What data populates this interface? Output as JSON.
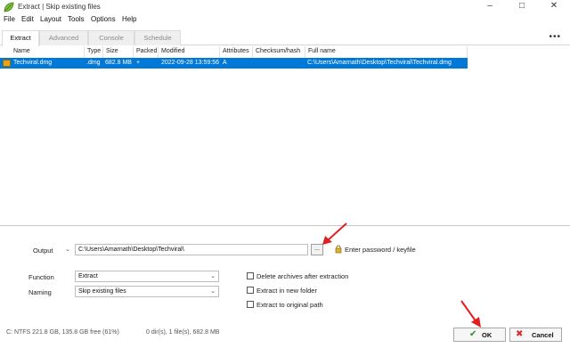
{
  "window": {
    "title": "Extract | Skip existing files"
  },
  "menu": [
    "File",
    "Edit",
    "Layout",
    "Tools",
    "Options",
    "Help"
  ],
  "tabs": [
    "Extract",
    "Advanced",
    "Console",
    "Schedule"
  ],
  "columns": [
    "Name",
    "Type",
    "Size",
    "Packed",
    "Modified",
    "Attributes",
    "Checksum/hash",
    "Full name"
  ],
  "files": [
    {
      "name": "Techviral.dmg",
      "type": ".dmg",
      "size": "682.8 MB",
      "packed": "+",
      "modified": "2022-09-28 13:59:56",
      "attributes": "A",
      "checksum": "",
      "fullname": "C:\\Users\\Amarnath\\Desktop\\Techviral\\Techviral.dmg"
    }
  ],
  "output": {
    "label": "Output",
    "path": "C:\\Users\\Amarnath\\Desktop\\Techviral\\",
    "browse_label": "...",
    "password_label": "Enter password / keyfile"
  },
  "function": {
    "label": "Function",
    "value": "Extract"
  },
  "naming": {
    "label": "Naming",
    "value": "Skip existing files"
  },
  "options": [
    "Delete archives after extraction",
    "Extract in new folder",
    "Extract to original path"
  ],
  "status": {
    "disk": "C: NTFS 221.8 GB, 135.8 GB free (61%)",
    "summary": "0 dir(s), 1 file(s), 682.8 MB"
  },
  "buttons": {
    "ok": "OK",
    "cancel": "Cancel"
  },
  "colors": {
    "selection": "#0078d7",
    "annotation_arrow": "#e02020",
    "ok_check": "#2e8b2e",
    "cancel_x": "#d32f2f"
  }
}
